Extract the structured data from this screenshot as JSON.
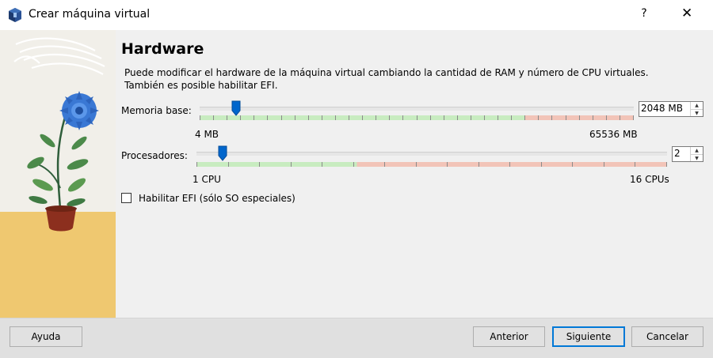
{
  "window": {
    "title": "Crear máquina virtual",
    "help_label": "?",
    "close_label": "✕"
  },
  "page": {
    "heading": "Hardware",
    "description_line1": "Puede modificar el hardware de la máquina virtual cambiando la cantidad de RAM y número de CPU virtuales.",
    "description_line2": "También es posible habilitar EFI."
  },
  "memory": {
    "label": "Memoria base:",
    "value": "2048 MB",
    "min_label": "4 MB",
    "max_label": "65536 MB",
    "min_mb": 4,
    "max_mb": 65536,
    "current_mb": 2048,
    "recommended_fraction": 0.75
  },
  "processors": {
    "label": "Procesadores:",
    "value": "2",
    "min_label": "1 CPU",
    "max_label": "16 CPUs",
    "min": 1,
    "max": 16,
    "current": 2,
    "recommended_max": 8
  },
  "efi": {
    "label": "Habilitar EFI (sólo SO especiales)",
    "checked": false
  },
  "buttons": {
    "help": "Ayuda",
    "back": "Anterior",
    "next": "Siguiente",
    "cancel": "Cancelar"
  },
  "colors": {
    "ok_zone": "#c8ecc0",
    "warn_zone": "#f2c4b8",
    "accent": "#0078d7"
  }
}
